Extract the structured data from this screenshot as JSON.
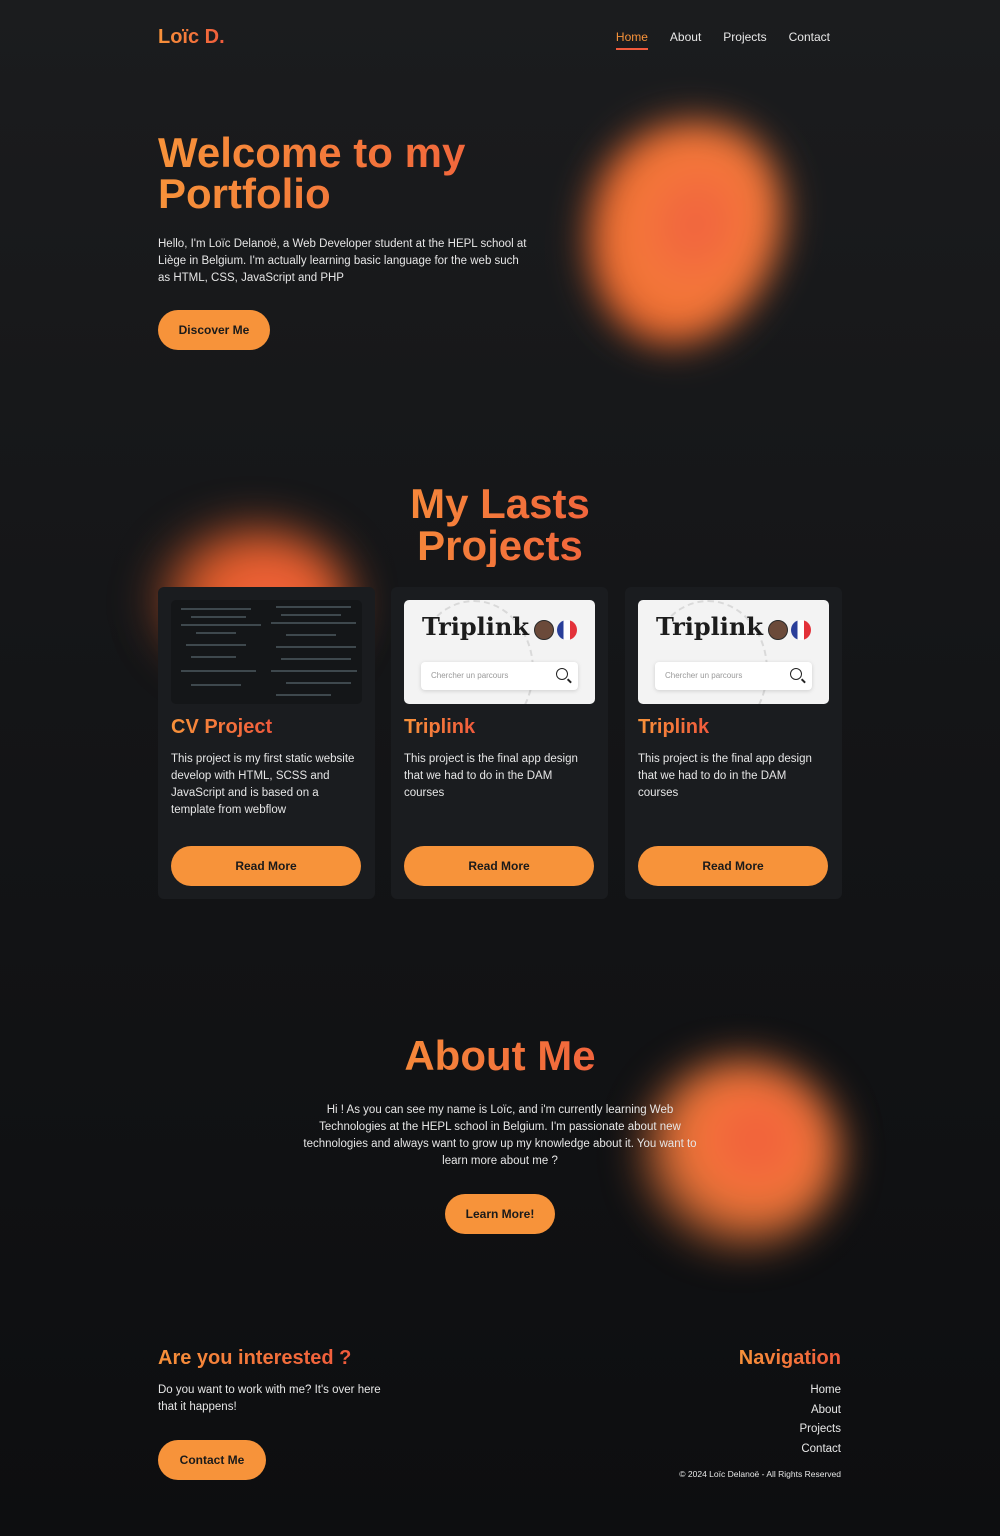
{
  "header": {
    "logo": "Loïc D.",
    "nav": [
      "Home",
      "About",
      "Projects",
      "Contact"
    ]
  },
  "hero": {
    "title_line1": "Welcome to my",
    "title_line2": "Portfolio",
    "text": "Hello, I'm Loïc Delanoë, a Web Developer student at the HEPL school at Liège in Belgium. I'm actually learning basic language for the web such as HTML, CSS, JavaScript and PHP",
    "button": "Discover Me"
  },
  "projects": {
    "title_line1": "My Lasts",
    "title_line2": "Projects",
    "cards": [
      {
        "title": "CV Project",
        "text": "This project is my first static website develop with HTML, SCSS and JavaScript and is based on a template from webflow",
        "button": "Read More"
      },
      {
        "title": "Triplink",
        "image_wordmark": "Triplink",
        "image_search_placeholder": "Chercher un parcours",
        "text": "This project is the final app design that we had to do in the DAM courses",
        "button": "Read More"
      },
      {
        "title": "Triplink",
        "image_wordmark": "Triplink",
        "image_search_placeholder": "Chercher un parcours",
        "text": "This project is the final app design that we had to do in the DAM courses",
        "button": "Read More"
      }
    ]
  },
  "about": {
    "title": "About Me",
    "text": "Hi ! As you can see my name is Loïc, and i'm currently learning Web Technologies at the HEPL school in Belgium. I'm passionate about new technologies and always want to grow up my knowledge about it. You want to learn more about me ?",
    "button": "Learn More!"
  },
  "footer": {
    "left_title": "Are you interested ?",
    "left_text": "Do you want to work with me? It's over here that it happens!",
    "button": "Contact Me",
    "nav_title": "Navigation",
    "nav": [
      "Home",
      "About",
      "Projects",
      "Contact"
    ],
    "copyright": "© 2024 Loïc Delanoë - All Rights Reserved"
  },
  "colors": {
    "accent_orange": "#f7933a",
    "accent_red": "#f05a3c",
    "background": "#141517",
    "card": "#1a1c1f"
  }
}
